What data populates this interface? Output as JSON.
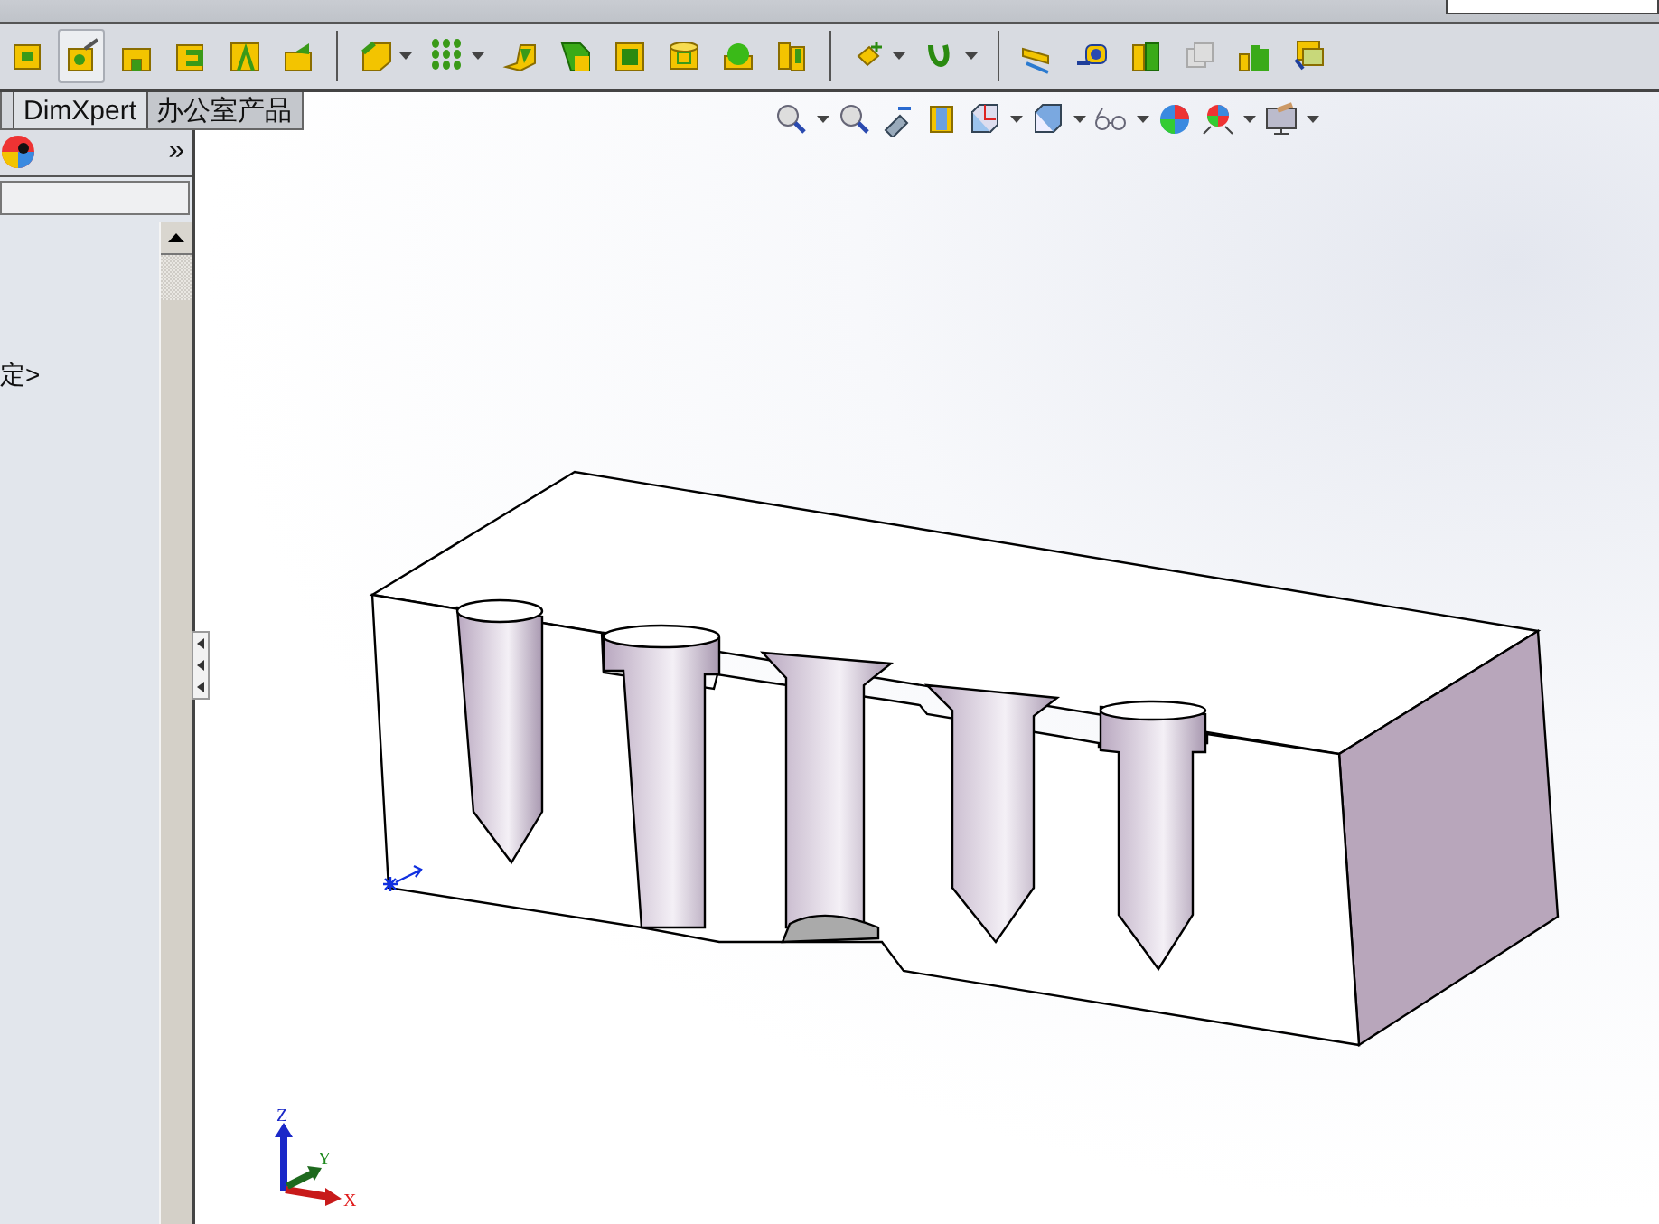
{
  "toolbar": {
    "buttons": [
      {
        "kind": "plain",
        "selected": false
      },
      {
        "kind": "plain",
        "selected": true
      },
      {
        "kind": "plain",
        "selected": false
      },
      {
        "kind": "plain",
        "selected": false
      },
      {
        "kind": "plain",
        "selected": false
      },
      {
        "kind": "plain",
        "selected": false
      },
      {
        "kind": "separator"
      },
      {
        "kind": "menu",
        "selected": false
      },
      {
        "kind": "menu",
        "selected": false
      },
      {
        "kind": "plain",
        "selected": false
      },
      {
        "kind": "plain",
        "selected": false
      },
      {
        "kind": "plain",
        "selected": false
      },
      {
        "kind": "plain",
        "selected": false
      },
      {
        "kind": "plain",
        "selected": false
      },
      {
        "kind": "plain",
        "selected": false
      },
      {
        "kind": "separator"
      },
      {
        "kind": "menu",
        "selected": false
      },
      {
        "kind": "menu",
        "selected": false
      },
      {
        "kind": "separator"
      },
      {
        "kind": "plain",
        "selected": false
      },
      {
        "kind": "plain",
        "selected": false
      },
      {
        "kind": "plain",
        "selected": false
      },
      {
        "kind": "plain",
        "selected": false
      },
      {
        "kind": "plain",
        "selected": false
      },
      {
        "kind": "plain",
        "selected": false
      }
    ]
  },
  "tabs": [
    {
      "label": "DimXpert",
      "selected": false
    },
    {
      "label": "办公室产品",
      "selected": true
    }
  ],
  "panel": {
    "expand_button": "»",
    "tree": [
      {
        "label": "定>"
      }
    ]
  },
  "viewport": {
    "triad": {
      "x": "X",
      "y": "Y",
      "z": "Z"
    }
  }
}
